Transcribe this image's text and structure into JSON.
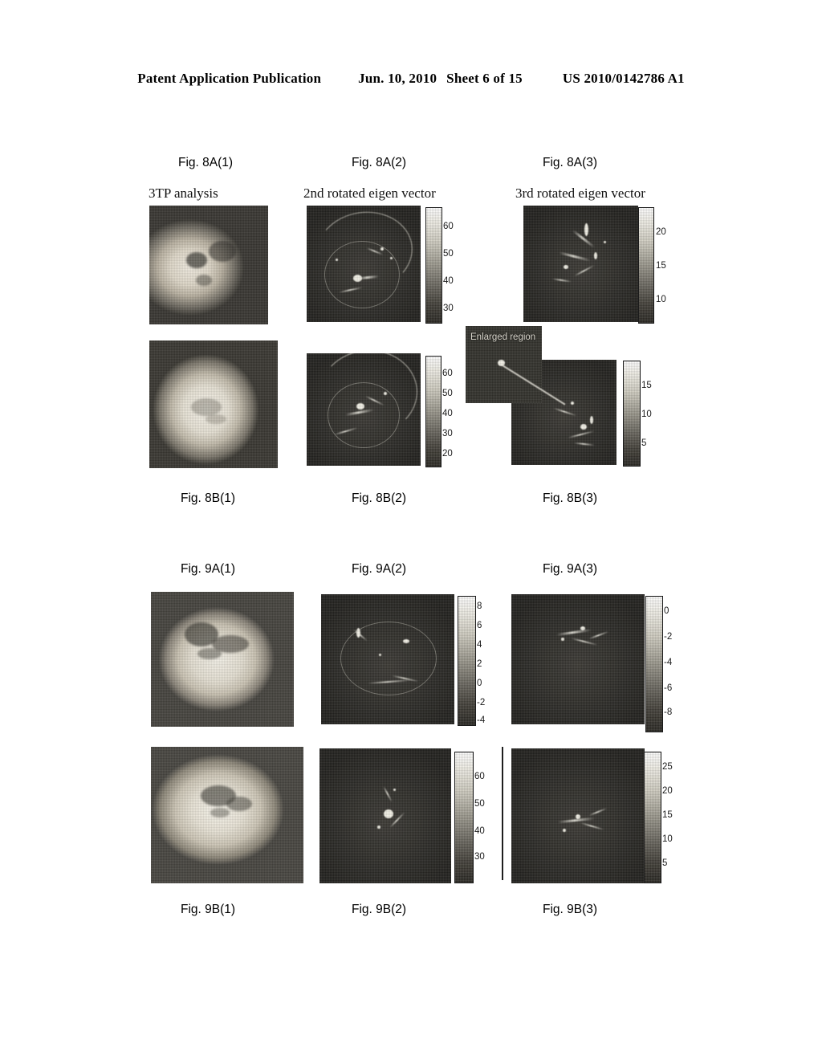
{
  "header": {
    "publication": "Patent Application Publication",
    "date": "Jun. 10, 2010",
    "sheet": "Sheet 6 of 15",
    "patent_number": "US 2010/0142786 A1"
  },
  "figures": {
    "fig8a": {
      "labels": [
        "Fig. 8A(1)",
        "Fig. 8A(2)",
        "Fig. 8A(3)"
      ],
      "captions": [
        "3TP analysis",
        "2nd rotated eigen vector",
        "3rd rotated eigen vector"
      ],
      "colorbars": [
        {
          "panel": "Fig. 8A(2)",
          "ticks": [
            "60",
            "50",
            "40",
            "30"
          ]
        },
        {
          "panel": "Fig. 8A(3)",
          "ticks": [
            "20",
            "15",
            "10"
          ]
        }
      ]
    },
    "fig8b": {
      "labels": [
        "Fig. 8B(1)",
        "Fig. 8B(2)",
        "Fig. 8B(3)"
      ],
      "inset_label": "Enlarged region",
      "colorbars": [
        {
          "panel": "Fig. 8B(2)",
          "ticks": [
            "60",
            "50",
            "40",
            "30",
            "20"
          ]
        },
        {
          "panel": "Fig. 8B(3)",
          "ticks": [
            "15",
            "10",
            "5"
          ]
        }
      ]
    },
    "fig9a": {
      "labels": [
        "Fig. 9A(1)",
        "Fig. 9A(2)",
        "Fig. 9A(3)"
      ],
      "colorbars": [
        {
          "panel": "Fig. 9A(2)",
          "ticks": [
            "8",
            "6",
            "4",
            "2",
            "0",
            "-2",
            "-4"
          ]
        },
        {
          "panel": "Fig. 9A(3)",
          "ticks": [
            "0",
            "-2",
            "-4",
            "-6",
            "-8"
          ]
        }
      ]
    },
    "fig9b": {
      "labels": [
        "Fig. 9B(1)",
        "Fig. 9B(2)",
        "Fig. 9B(3)"
      ],
      "colorbars": [
        {
          "panel": "Fig. 9B(2)",
          "ticks": [
            "60",
            "50",
            "40",
            "30"
          ]
        },
        {
          "panel": "Fig. 9B(3)",
          "ticks": [
            "25",
            "20",
            "15",
            "10",
            "5"
          ]
        }
      ]
    }
  },
  "colors": {
    "page_background": "#ffffff",
    "text": "#000000",
    "panel_dark": "#2a2a2a",
    "panel_light": "#f2efe6"
  }
}
